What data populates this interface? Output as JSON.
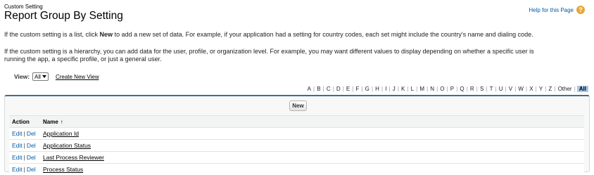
{
  "header": {
    "subtitle": "Custom Setting",
    "title": "Report Group By Setting",
    "help_label": "Help for this Page",
    "help_icon": "?"
  },
  "description": {
    "p1_before": "If the custom setting is a list, click ",
    "p1_bold": "New",
    "p1_after": " to add a new set of data. For example, if your application had a setting for country codes, each set might include the country's name and dialing code.",
    "p2_line1": "If the custom setting is a hierarchy, you can add data for the user, profile, or organization level. For example, you may want different values to display depending on whether a specific user is",
    "p2_line2": "running the app, a specific profile, or just a general user."
  },
  "view": {
    "label": "View:",
    "selected": "All",
    "create_link": "Create New View"
  },
  "alphabet": {
    "letters": [
      "A",
      "B",
      "C",
      "D",
      "E",
      "F",
      "G",
      "H",
      "I",
      "J",
      "K",
      "L",
      "M",
      "N",
      "O",
      "P",
      "Q",
      "R",
      "S",
      "T",
      "U",
      "V",
      "W",
      "X",
      "Y",
      "Z",
      "Other"
    ],
    "all_label": "All"
  },
  "list": {
    "new_button": "New",
    "columns": {
      "action": "Action",
      "name": "Name",
      "sort_indicator": "↑"
    },
    "rows": [
      {
        "edit": "Edit",
        "sep": "|",
        "del": "Del",
        "name": "Application Id"
      },
      {
        "edit": "Edit",
        "sep": "|",
        "del": "Del",
        "name": "Application Status"
      },
      {
        "edit": "Edit",
        "sep": "|",
        "del": "Del",
        "name": "Last Process Reviewer"
      },
      {
        "edit": "Edit",
        "sep": "|",
        "del": "Del",
        "name": "Process Status"
      }
    ]
  },
  "colors": {
    "link": "#015ba7",
    "help_icon": "#e5a93a",
    "list_border_top": "#3b6d94",
    "all_highlight": "#a8c8e8"
  }
}
